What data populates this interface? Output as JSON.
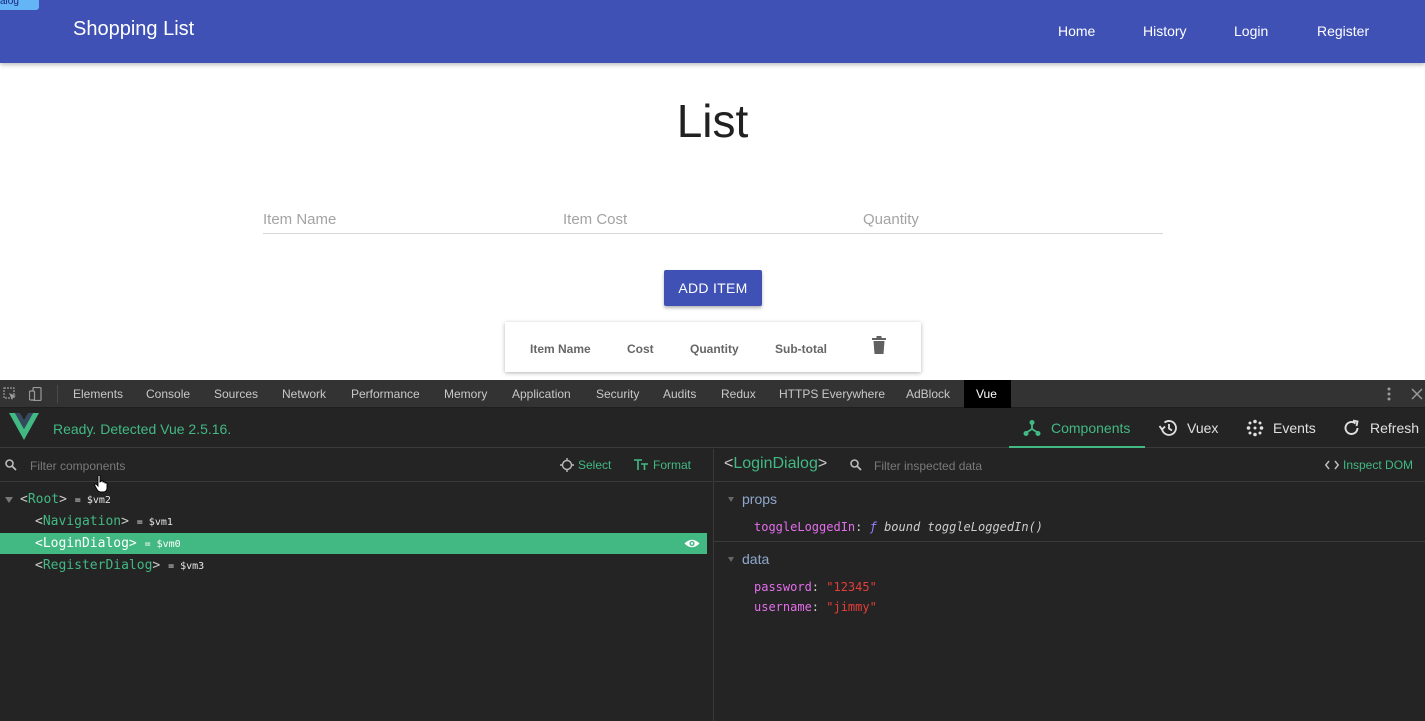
{
  "app": {
    "corner_tag": "alog",
    "brand": "Shopping List",
    "nav": [
      "Home",
      "History",
      "Login",
      "Register"
    ]
  },
  "main": {
    "title": "List",
    "fields": {
      "item_name_placeholder": "Item Name",
      "item_cost_placeholder": "Item Cost",
      "quantity_placeholder": "Quantity"
    },
    "add_button": "ADD ITEM",
    "table_headers": [
      "Item Name",
      "Cost",
      "Quantity",
      "Sub-total"
    ]
  },
  "devtools": {
    "tabs": [
      "Elements",
      "Console",
      "Sources",
      "Network",
      "Performance",
      "Memory",
      "Application",
      "Security",
      "Audits",
      "Redux",
      "HTTPS Everywhere",
      "AdBlock",
      "Vue"
    ],
    "active_tab": "Vue",
    "vue": {
      "status": "Ready. Detected Vue 2.5.16.",
      "header_tabs": [
        "Components",
        "Vuex",
        "Events",
        "Refresh"
      ],
      "filter_placeholder": "Filter components",
      "select_label": "Select",
      "format_label": "Format",
      "tree": [
        {
          "name": "Root",
          "ref": "= $vm2"
        },
        {
          "name": "Navigation",
          "ref": "= $vm1"
        },
        {
          "name": "LoginDialog",
          "ref": "= $vm0"
        },
        {
          "name": "RegisterDialog",
          "ref": "= $vm3"
        }
      ],
      "inspector": {
        "component": "LoginDialog",
        "filter_placeholder": "Filter inspected data",
        "inspect_dom_label": "Inspect DOM",
        "props_label": "props",
        "props": [
          {
            "key": "toggleLoggedIn",
            "fn_marker": "ƒ",
            "value": "bound toggleLoggedIn()"
          }
        ],
        "data_label": "data",
        "data": [
          {
            "key": "password",
            "value": "\"12345\""
          },
          {
            "key": "username",
            "value": "\"jimmy\""
          }
        ]
      }
    }
  },
  "colors": {
    "primary": "#3f51b5",
    "vue_green": "#42b983",
    "devtools_bg": "#242424"
  }
}
